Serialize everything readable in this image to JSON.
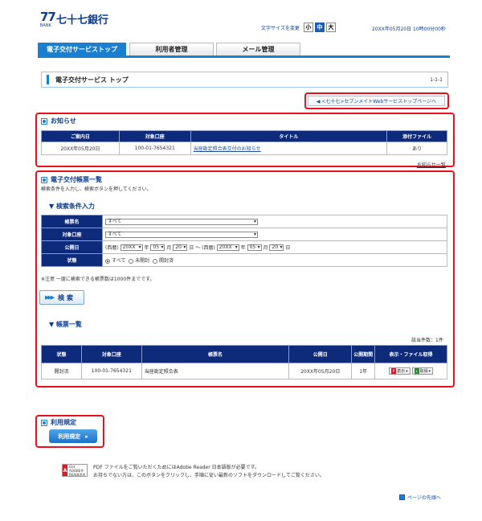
{
  "header": {
    "logo_number": "77",
    "logo_bank": "BANK",
    "logo_name": "七十七銀行",
    "font_size_label": "文字サイズを変更",
    "font_sizes": [
      "小",
      "中",
      "大"
    ],
    "font_size_selected": "中",
    "datetime": "20XX年05月20日 10時00分00秒"
  },
  "tabs": [
    {
      "label": "電子交付サービストップ",
      "active": true
    },
    {
      "label": "利用者管理",
      "active": false
    },
    {
      "label": "メール管理",
      "active": false
    }
  ],
  "page": {
    "title": "電子交付サービス トップ",
    "id": "1-1-1"
  },
  "top_link": "◀ <七十七>セブンメイトWebサービストップページへ",
  "notice": {
    "heading": "お知らせ",
    "columns": [
      "ご案内日",
      "対象口座",
      "タイトル",
      "添付ファイル"
    ],
    "rows": [
      {
        "date": "20XX年05月20日",
        "account": "100-01-7654321",
        "title": "当座勘定照合表交付のお知らせ",
        "attachment": "あり"
      }
    ],
    "list_link": "お知らせ一覧"
  },
  "ledger": {
    "heading": "電子交付帳票一覧",
    "instruction": "検索条件を入力し、検索ボタンを押してください。",
    "search_heading": "▼ 検索条件入力",
    "fields": {
      "form_name_label": "帳票名",
      "form_name_value": "すべて",
      "account_label": "対象口座",
      "account_value": "すべて",
      "date_label": "公開日",
      "date_from_era": "(西暦)",
      "date_from_year": "20XX",
      "date_from_month": "05",
      "date_from_day": "20",
      "date_sep": "〜",
      "date_to_era": "(西暦)",
      "date_to_year": "20XX",
      "date_to_month": "05",
      "date_to_day": "20",
      "unit_year": "年",
      "unit_month": "月",
      "unit_day": "日",
      "status_label": "状態",
      "status_options": [
        "すべて",
        "未開封",
        "開封済"
      ],
      "status_selected": "すべて"
    },
    "note": "※注意 一度に検索できる帳票数は1000件までです。",
    "search_button": "検 索",
    "list_heading": "▼ 帳票一覧",
    "count": "該当件数：1件",
    "columns": [
      "状態",
      "対象口座",
      "帳票名",
      "公開日",
      "公開期間",
      "表示・ファイル取得"
    ],
    "rows": [
      {
        "status": "開封済",
        "account": "100-01-7654321",
        "form": "当座勘定照合表",
        "date": "20XX年05月20日",
        "period": "1年",
        "view_label": "表示",
        "get_label": "取得"
      }
    ]
  },
  "rules": {
    "heading": "利用規定",
    "button": "利用規定"
  },
  "adobe": {
    "badge_top": "Get",
    "badge_bottom": "ADOBE® READER®",
    "text1": "PDF ファイルをご覧いただくためにはAdobe Reader 日本語版が必要です。",
    "text2": "お持ちでない方は、このボタンをクリックし、手順に従い最新のソフトをダウンロードしてご覧ください。"
  },
  "page_top": "ページの先頭へ",
  "colors": {
    "accent": "#1a7fcf",
    "header_navy": "#0e2a7a",
    "highlight": "#e8101a"
  }
}
